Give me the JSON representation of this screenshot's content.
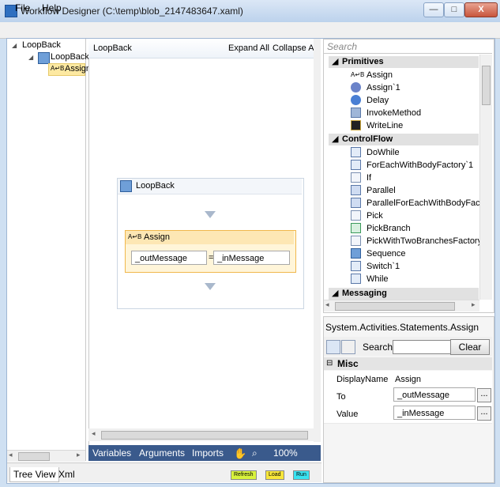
{
  "window": {
    "title": "Workflow Designer (C:\\temp\\blob_2147483647.xaml)",
    "min_glyph": "—",
    "max_glyph": "□",
    "close_glyph": "X"
  },
  "menu": {
    "file": "File",
    "help": "Help"
  },
  "tree": {
    "root": "LoopBack",
    "child": "LoopBack",
    "leaf": "Assign",
    "expand_glyph": "◢"
  },
  "designer": {
    "breadcrumb": "LoopBack",
    "expand_all": "Expand All",
    "collapse_all": "Collapse All",
    "sequence_title": "LoopBack",
    "assign_title": "Assign",
    "assign_to": "_outMessage",
    "assign_eq": "=",
    "assign_value": "_inMessage",
    "bottom_variables": "Variables",
    "bottom_arguments": "Arguments",
    "bottom_imports": "Imports",
    "zoom": "100%"
  },
  "toolbox": {
    "search_placeholder": "Search",
    "categories": [
      {
        "name": "Primitives",
        "items": [
          "Assign",
          "Assign`1",
          "Delay",
          "InvokeMethod",
          "WriteLine"
        ]
      },
      {
        "name": "ControlFlow",
        "items": [
          "DoWhile",
          "ForEachWithBodyFactory`1",
          "If",
          "Parallel",
          "ParallelForEachWithBodyFactor",
          "Pick",
          "PickBranch",
          "PickWithTwoBranchesFactory",
          "Sequence",
          "Switch`1",
          "While"
        ]
      },
      {
        "name": "Messaging",
        "items": []
      }
    ]
  },
  "properties": {
    "type_name": "System.Activities.Statements.Assign",
    "search_label": "Search:",
    "clear_label": "Clear",
    "category": "Misc",
    "rows": [
      {
        "name": "DisplayName",
        "value": "Assign"
      },
      {
        "name": "To",
        "value": "_outMessage"
      },
      {
        "name": "Value",
        "value": "_inMessage"
      }
    ],
    "ellipsis": "..."
  },
  "bottom": {
    "tab_treeview": "Tree View",
    "tab_xml": "Xml",
    "refresh": "Refresh",
    "load": "Load",
    "run": "Run"
  },
  "colors": {
    "accent_bar": "#3a5a8c",
    "assign_border": "#f0b84d",
    "refresh_bg": "#d8f23c",
    "load_bg": "#f7e63a",
    "run_bg": "#39e2f0"
  }
}
